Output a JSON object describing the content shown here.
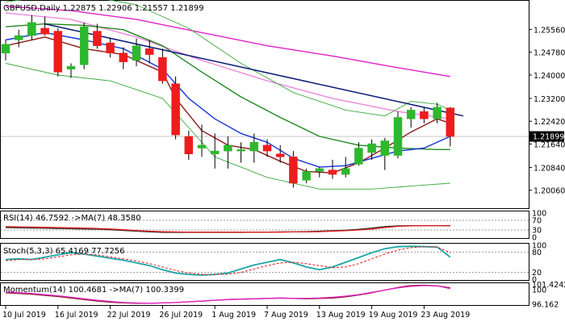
{
  "header": {
    "main": "GBPUSD,Daily  1.22875 1.22906 1.21557 1.21899",
    "rsi": "RSI(14) 46.7592  ->MA(7) 48.3580",
    "stoch": "Stoch(5,3,3) 65.4169 77.7256",
    "mom": "Momentum(14) 100.4681  ->MA(7) 100.3399"
  },
  "colors": {
    "bull": "#2db82d",
    "bear": "#ee1c1c",
    "ma_magenta": "#e020c8",
    "ma_pink": "#ee88dd",
    "ma_blue": "#1535d8",
    "ma_darkred": "#8b1a1a",
    "ma_green": "#1f8a1f",
    "bb_green": "#3caa3c",
    "trendline": "#0a1a78",
    "stoch_main": "#1aa5a5",
    "stoch_signal": "#e21c1c",
    "rsi_line": "#333333",
    "rsi_ma": "#e21c1c",
    "price_tag_bg": "#000000",
    "price_tag_text": "#ffffff"
  },
  "chart_data": [
    {
      "type": "candlestick",
      "symbol": "GBPUSD",
      "timeframe": "Daily",
      "ylim": [
        1.195,
        1.264
      ],
      "y_ticks": [
        "1.25560",
        "1.24780",
        "1.24000",
        "1.23200",
        "1.22420",
        "1.21640",
        "1.20840",
        "1.20060"
      ],
      "current_price": "1.21899",
      "x_ticks": [
        {
          "i": 0,
          "label": "10 Jul 2019"
        },
        {
          "i": 4,
          "label": "16 Jul 2019"
        },
        {
          "i": 8,
          "label": "22 Jul 2019"
        },
        {
          "i": 12,
          "label": "26 Jul 2019"
        },
        {
          "i": 16,
          "label": "1 Aug 2019"
        },
        {
          "i": 20,
          "label": "7 Aug 2019"
        },
        {
          "i": 24,
          "label": "13 Aug 2019"
        },
        {
          "i": 28,
          "label": "19 Aug 2019"
        },
        {
          "i": 32,
          "label": "23 Aug 2019"
        }
      ],
      "candles": [
        {
          "o": 1.2475,
          "h": 1.252,
          "l": 1.245,
          "c": 1.2505
        },
        {
          "o": 1.252,
          "h": 1.2555,
          "l": 1.2495,
          "c": 1.2535
        },
        {
          "o": 1.2535,
          "h": 1.2605,
          "l": 1.252,
          "c": 1.258
        },
        {
          "o": 1.256,
          "h": 1.26,
          "l": 1.2535,
          "c": 1.254
        },
        {
          "o": 1.255,
          "h": 1.256,
          "l": 1.2395,
          "c": 1.241
        },
        {
          "o": 1.242,
          "h": 1.244,
          "l": 1.239,
          "c": 1.243
        },
        {
          "o": 1.2435,
          "h": 1.258,
          "l": 1.242,
          "c": 1.2565
        },
        {
          "o": 1.255,
          "h": 1.2575,
          "l": 1.249,
          "c": 1.25
        },
        {
          "o": 1.251,
          "h": 1.2525,
          "l": 1.246,
          "c": 1.2475
        },
        {
          "o": 1.2475,
          "h": 1.2495,
          "l": 1.242,
          "c": 1.2445
        },
        {
          "o": 1.245,
          "h": 1.2525,
          "l": 1.243,
          "c": 1.25
        },
        {
          "o": 1.249,
          "h": 1.252,
          "l": 1.244,
          "c": 1.247
        },
        {
          "o": 1.246,
          "h": 1.249,
          "l": 1.237,
          "c": 1.238
        },
        {
          "o": 1.237,
          "h": 1.2395,
          "l": 1.218,
          "c": 1.2195
        },
        {
          "o": 1.219,
          "h": 1.221,
          "l": 1.211,
          "c": 1.213
        },
        {
          "o": 1.215,
          "h": 1.223,
          "l": 1.212,
          "c": 1.216
        },
        {
          "o": 1.213,
          "h": 1.22,
          "l": 1.208,
          "c": 1.214
        },
        {
          "o": 1.214,
          "h": 1.219,
          "l": 1.208,
          "c": 1.216
        },
        {
          "o": 1.214,
          "h": 1.217,
          "l": 1.21,
          "c": 1.2145
        },
        {
          "o": 1.214,
          "h": 1.22,
          "l": 1.21,
          "c": 1.217
        },
        {
          "o": 1.216,
          "h": 1.218,
          "l": 1.212,
          "c": 1.214
        },
        {
          "o": 1.213,
          "h": 1.216,
          "l": 1.21,
          "c": 1.212
        },
        {
          "o": 1.212,
          "h": 1.214,
          "l": 1.2015,
          "c": 1.203
        },
        {
          "o": 1.204,
          "h": 1.208,
          "l": 1.203,
          "c": 1.207
        },
        {
          "o": 1.207,
          "h": 1.2085,
          "l": 1.205,
          "c": 1.208
        },
        {
          "o": 1.2075,
          "h": 1.211,
          "l": 1.2045,
          "c": 1.206
        },
        {
          "o": 1.206,
          "h": 1.212,
          "l": 1.205,
          "c": 1.208
        },
        {
          "o": 1.2095,
          "h": 1.217,
          "l": 1.209,
          "c": 1.215
        },
        {
          "o": 1.2135,
          "h": 1.218,
          "l": 1.211,
          "c": 1.2165
        },
        {
          "o": 1.2125,
          "h": 1.2185,
          "l": 1.2075,
          "c": 1.2175
        },
        {
          "o": 1.2125,
          "h": 1.2275,
          "l": 1.2115,
          "c": 1.2255
        },
        {
          "o": 1.225,
          "h": 1.229,
          "l": 1.222,
          "c": 1.228
        },
        {
          "o": 1.2275,
          "h": 1.229,
          "l": 1.2235,
          "c": 1.225
        },
        {
          "o": 1.225,
          "h": 1.2305,
          "l": 1.2235,
          "c": 1.229
        },
        {
          "o": 1.22875,
          "h": 1.22906,
          "l": 1.21557,
          "c": 1.21899
        }
      ],
      "moving_averages": [
        {
          "color_key": "ma_magenta",
          "points": [
            [
              0,
              1.2635
            ],
            [
              5,
              1.262
            ],
            [
              10,
              1.259
            ],
            [
              15,
              1.2545
            ],
            [
              20,
              1.25
            ],
            [
              25,
              1.2465
            ],
            [
              30,
              1.2425
            ],
            [
              34,
              1.2395
            ]
          ]
        },
        {
          "color_key": "ma_pink",
          "points": [
            [
              0,
              1.2612
            ],
            [
              5,
              1.259
            ],
            [
              10,
              1.253
            ],
            [
              15,
              1.245
            ],
            [
              20,
              1.238
            ],
            [
              25,
              1.232
            ],
            [
              30,
              1.2275
            ],
            [
              34,
              1.225
            ]
          ]
        },
        {
          "color_key": "ma_green",
          "points": [
            [
              0,
              1.2565
            ],
            [
              3,
              1.2575
            ],
            [
              6,
              1.257
            ],
            [
              9,
              1.2555
            ],
            [
              12,
              1.25
            ],
            [
              15,
              1.241
            ],
            [
              18,
              1.2325
            ],
            [
              21,
              1.2255
            ],
            [
              24,
              1.219
            ],
            [
              27,
              1.216
            ],
            [
              30,
              1.215
            ],
            [
              33,
              1.2145
            ],
            [
              34,
              1.2145
            ]
          ]
        },
        {
          "color_key": "ma_blue",
          "points": [
            [
              0,
              1.252
            ],
            [
              3,
              1.2545
            ],
            [
              6,
              1.252
            ],
            [
              9,
              1.249
            ],
            [
              12,
              1.242
            ],
            [
              14,
              1.232
            ],
            [
              16,
              1.225
            ],
            [
              18,
              1.22
            ],
            [
              20,
              1.217
            ],
            [
              22,
              1.2115
            ],
            [
              24,
              1.2085
            ],
            [
              26,
              1.209
            ],
            [
              28,
              1.2115
            ],
            [
              30,
              1.214
            ],
            [
              32,
              1.215
            ],
            [
              34,
              1.219
            ]
          ]
        },
        {
          "color_key": "ma_darkred",
          "points": [
            [
              0,
              1.25
            ],
            [
              3,
              1.253
            ],
            [
              6,
              1.249
            ],
            [
              9,
              1.247
            ],
            [
              12,
              1.241
            ],
            [
              13,
              1.232
            ],
            [
              15,
              1.221
            ],
            [
              17,
              1.216
            ],
            [
              19,
              1.2145
            ],
            [
              21,
              1.2105
            ],
            [
              23,
              1.207
            ],
            [
              25,
              1.2065
            ],
            [
              27,
              1.21
            ],
            [
              29,
              1.215
            ],
            [
              31,
              1.2205
            ],
            [
              33,
              1.225
            ],
            [
              34,
              1.2235
            ]
          ]
        },
        {
          "color_key": "bb_green",
          "points": [
            [
              0,
              1.265
            ],
            [
              5,
              1.268
            ],
            [
              10,
              1.264
            ],
            [
              14,
              1.256
            ],
            [
              18,
              1.244
            ],
            [
              22,
              1.234
            ],
            [
              26,
              1.228
            ],
            [
              29,
              1.226
            ],
            [
              31,
              1.231
            ],
            [
              33,
              1.23
            ],
            [
              34,
              1.228
            ]
          ]
        },
        {
          "color_key": "bb_green",
          "points": [
            [
              0,
              1.244
            ],
            [
              4,
              1.24
            ],
            [
              8,
              1.238
            ],
            [
              12,
              1.232
            ],
            [
              16,
              1.212
            ],
            [
              20,
              1.205
            ],
            [
              24,
              1.201
            ],
            [
              28,
              1.201
            ],
            [
              31,
              1.202
            ],
            [
              34,
              1.203
            ]
          ]
        }
      ],
      "trendline": {
        "points": [
          [
            3,
            1.2575
          ],
          [
            35,
            1.226
          ]
        ]
      },
      "guide_lines": [
        1.21899
      ]
    },
    {
      "type": "line",
      "name": "RSI",
      "ylim": [
        0,
        100
      ],
      "y_ticks": [
        "100",
        "70",
        "30",
        "0"
      ],
      "series": [
        {
          "color_key": "rsi_line",
          "values": [
            40,
            39,
            38,
            37,
            36,
            35,
            34,
            33,
            31,
            28,
            25,
            22,
            20,
            20,
            20,
            20,
            20,
            20,
            20,
            21,
            21,
            22,
            22,
            23,
            25,
            27,
            29,
            33,
            38,
            44,
            47,
            48,
            48,
            48,
            47
          ]
        },
        {
          "color_key": "rsi_ma",
          "values": [
            44,
            43,
            42,
            41,
            40,
            39,
            38,
            36,
            34,
            31,
            28,
            25,
            23,
            22,
            21,
            21,
            21,
            21,
            21,
            21,
            21,
            21,
            22,
            22,
            23,
            25,
            27,
            30,
            34,
            40,
            45,
            47,
            48,
            48,
            48
          ]
        }
      ]
    },
    {
      "type": "line",
      "name": "Stoch",
      "ylim": [
        0,
        100
      ],
      "y_ticks": [
        "100",
        "80",
        "20",
        "0"
      ],
      "series": [
        {
          "color_key": "stoch_main",
          "values": [
            58,
            60,
            58,
            65,
            72,
            78,
            74,
            68,
            62,
            56,
            48,
            40,
            28,
            18,
            14,
            12,
            14,
            18,
            30,
            42,
            50,
            58,
            48,
            36,
            28,
            36,
            50,
            64,
            78,
            90,
            96,
            97,
            96,
            95,
            65
          ]
        },
        {
          "color_key": "stoch_signal",
          "values": [
            55,
            58,
            58,
            60,
            66,
            72,
            74,
            72,
            66,
            60,
            54,
            46,
            36,
            26,
            18,
            14,
            14,
            15,
            20,
            30,
            40,
            48,
            50,
            46,
            40,
            34,
            36,
            46,
            60,
            74,
            86,
            93,
            96,
            95,
            78
          ]
        }
      ]
    },
    {
      "type": "line",
      "name": "Momentum",
      "ylim": [
        96.162,
        101.5
      ],
      "y_ticks": [
        "101.4242",
        "100",
        "96.162"
      ],
      "series": [
        {
          "color_key": "ma_darkred",
          "values": [
            99.2,
            99.0,
            98.8,
            98.5,
            98.2,
            97.8,
            97.4,
            97.0,
            96.7,
            96.5,
            96.4,
            96.4,
            96.5,
            96.6,
            96.8,
            97.0,
            97.2,
            97.4,
            97.5,
            97.6,
            97.7,
            97.8,
            97.7,
            97.6,
            97.7,
            97.8,
            98.1,
            98.6,
            99.2,
            99.9,
            100.6,
            101.1,
            101.2,
            101.0,
            100.5
          ]
        },
        {
          "color_key": "ma_magenta",
          "values": [
            99.4,
            99.2,
            99.0,
            98.7,
            98.4,
            98.0,
            97.6,
            97.2,
            96.9,
            96.6,
            96.5,
            96.4,
            96.5,
            96.6,
            96.8,
            97.0,
            97.2,
            97.4,
            97.5,
            97.6,
            97.7,
            97.8,
            97.7,
            97.7,
            97.8,
            98.0,
            98.3,
            98.7,
            99.3,
            99.9,
            100.5,
            100.9,
            101.1,
            101.0,
            100.3
          ]
        }
      ]
    }
  ]
}
